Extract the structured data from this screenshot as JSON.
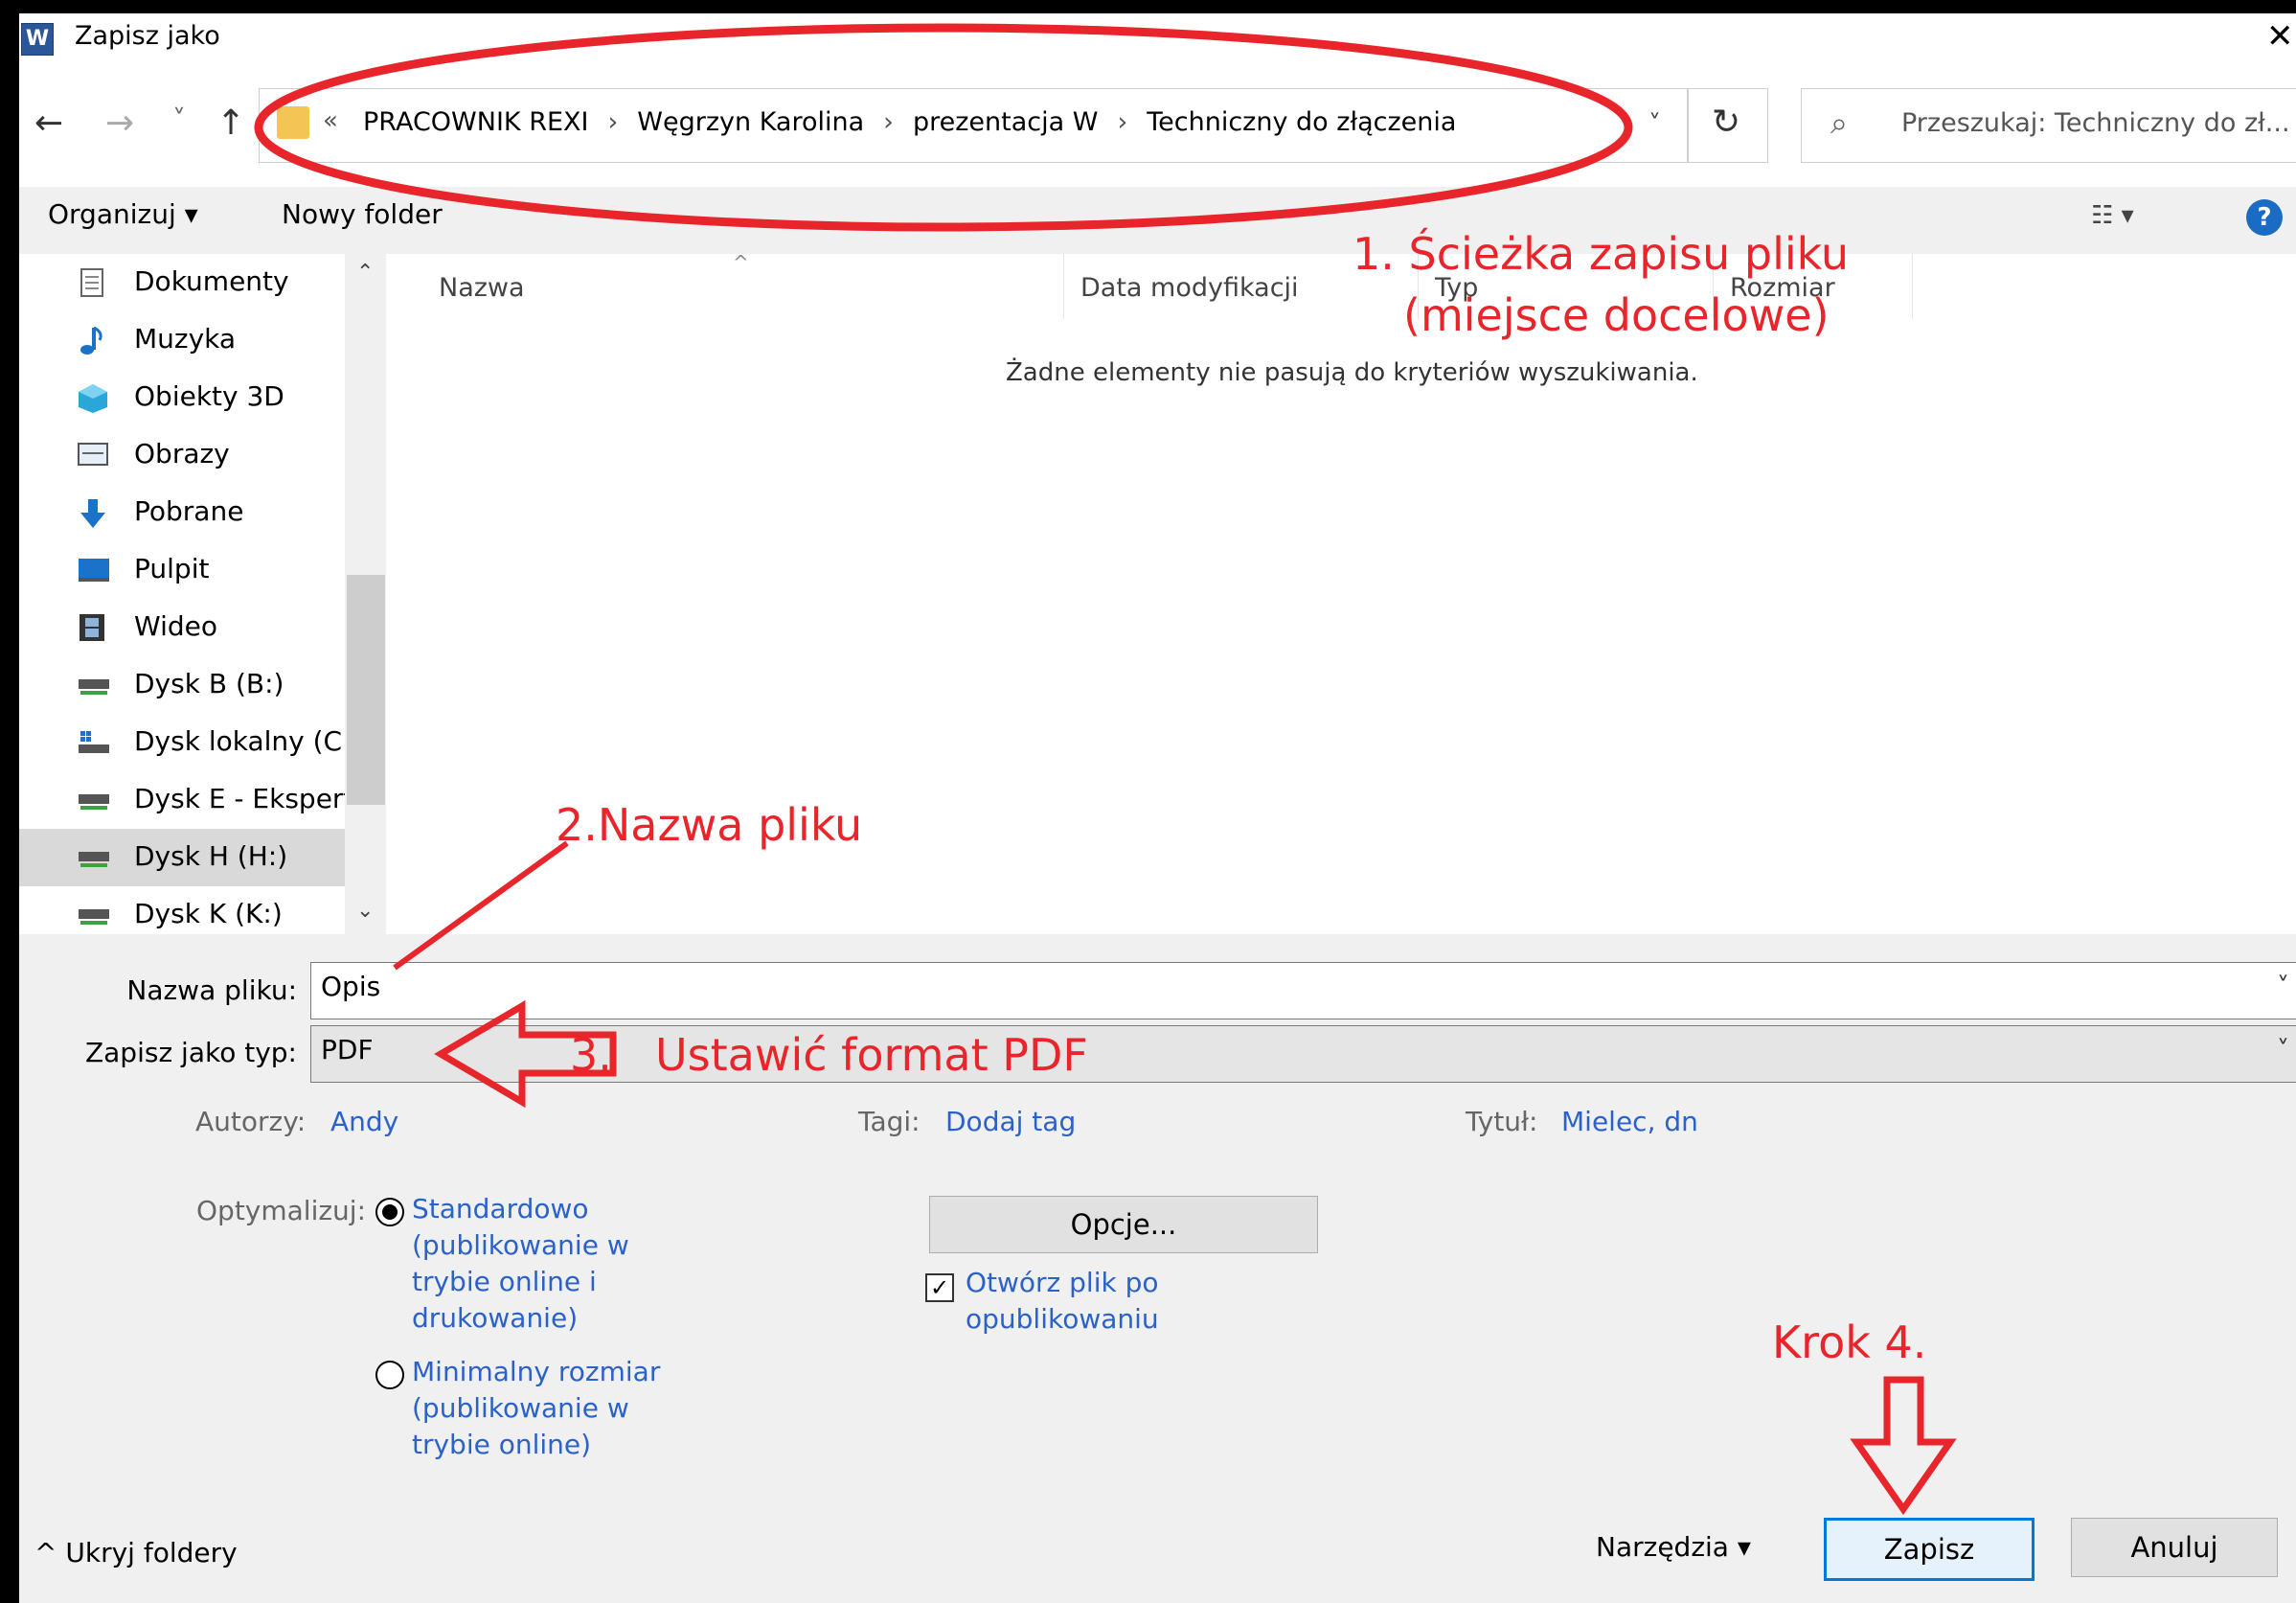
{
  "window": {
    "app_icon_letter": "W",
    "title": "Zapisz jako",
    "close_glyph": "✕"
  },
  "nav": {
    "back_glyph": "←",
    "forward_glyph": "→",
    "recent_glyph": "˅",
    "up_glyph": "↑",
    "address_prefix": "«",
    "crumbs": [
      "PRACOWNIK REXI",
      "Węgrzyn Karolina",
      "prezentacja W",
      "Techniczny do złączenia"
    ],
    "crumb_separator": "›",
    "refresh_glyph": "↻",
    "search_placeholder": "Przeszukaj: Techniczny do zł..."
  },
  "toolbar": {
    "organize_label": "Organizuj ▾",
    "new_folder_label": "Nowy folder",
    "view_glyph": "☷ ▾",
    "help_glyph": "?"
  },
  "sidebar": {
    "items": [
      {
        "label": "Dokumenty",
        "icon": "documents-icon"
      },
      {
        "label": "Muzyka",
        "icon": "music-icon"
      },
      {
        "label": "Obiekty 3D",
        "icon": "objects-3d-icon"
      },
      {
        "label": "Obrazy",
        "icon": "pictures-icon"
      },
      {
        "label": "Pobrane",
        "icon": "downloads-icon"
      },
      {
        "label": "Pulpit",
        "icon": "desktop-icon"
      },
      {
        "label": "Wideo",
        "icon": "video-icon"
      },
      {
        "label": "Dysk B (B:)",
        "icon": "drive-icon"
      },
      {
        "label": "Dysk lokalny (C:)",
        "icon": "local-drive-icon"
      },
      {
        "label": "Dysk E - Eksperty",
        "icon": "drive-icon"
      },
      {
        "label": "Dysk H (H:)",
        "icon": "drive-icon",
        "selected": true
      },
      {
        "label": "Dysk K (K:)",
        "icon": "drive-icon"
      }
    ]
  },
  "file_list": {
    "columns": [
      "Nazwa",
      "Data modyfikacji",
      "Typ",
      "Rozmiar"
    ],
    "empty_message": "Żadne elementy nie pasują do kryteriów wyszukiwania."
  },
  "form": {
    "filename_label": "Nazwa pliku:",
    "filename_value": "Opis",
    "filetype_label": "Zapisz jako typ:",
    "filetype_value": "PDF",
    "dropdown_glyph": "˅",
    "authors_label": "Autorzy:",
    "authors_value": "Andy",
    "tags_label": "Tagi:",
    "tags_value": "Dodaj tag",
    "title_label": "Tytuł:",
    "title_value": "Mielec, dn",
    "optimize_label": "Optymalizuj:",
    "optimize_options": [
      {
        "label": "Standardowo (publikowanie w trybie online i drukowanie)",
        "selected": true
      },
      {
        "label": "Minimalny rozmiar (publikowanie w trybie online)",
        "selected": false
      }
    ],
    "options_button": "Opcje...",
    "open_after_label": "Otwórz plik po opublikowaniu",
    "open_after_checked": true,
    "check_glyph": "✓"
  },
  "footer": {
    "hide_folders": "^  Ukryj foldery",
    "tools_label": "Narzędzia   ▾",
    "save_button": "Zapisz",
    "cancel_button": "Anuluj"
  },
  "annotations": {
    "color": "#e8252b",
    "step1_line1": "1. Ścieżka zapisu pliku",
    "step1_line2": "(miejsce docelowe)",
    "step2": "2.Nazwa pliku",
    "step3_num": "3.",
    "step3_text": "Ustawić format PDF",
    "step4": "Krok 4."
  }
}
